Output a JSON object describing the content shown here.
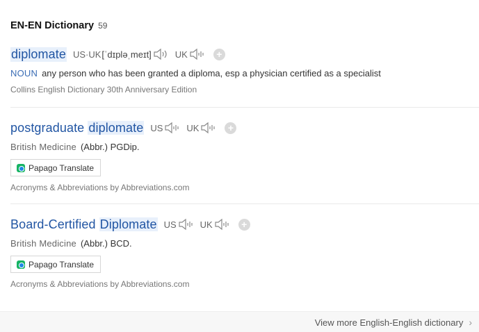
{
  "header": {
    "title": "EN-EN Dictionary",
    "count": "59"
  },
  "entries": [
    {
      "word": "diplomate",
      "us_uk_label": "US·UK",
      "phonetic": "[ˈdɪpləˌmeɪt]",
      "uk_label": "UK",
      "pos": "NOUN",
      "definition": "any person who has been granted a diploma, esp a physician certified as a specialist",
      "source": "Collins English Dictionary 30th Anniversary Edition"
    },
    {
      "word_prefix": "postgraduate ",
      "word_highlight": "diplomate",
      "us_label": "US",
      "uk_label": "UK",
      "pos": "British Medicine",
      "definition": "(Abbr.) PGDip.",
      "translate_label": "Papago Translate",
      "source": "Acronyms & Abbreviations by Abbreviations.com"
    },
    {
      "word_prefix": "Board-Certified ",
      "word_highlight": "Diplomate",
      "us_label": "US",
      "uk_label": "UK",
      "pos": "British Medicine",
      "definition": "(Abbr.) BCD.",
      "translate_label": "Papago Translate",
      "source": "Acronyms & Abbreviations by Abbreviations.com"
    }
  ],
  "footer": {
    "more_label": "View more English-English dictionary"
  },
  "icons": {
    "speaker": "speaker-icon",
    "add": "plus-icon",
    "translate": "papago-icon",
    "chevron": "chevron-right-icon"
  },
  "colors": {
    "link": "#2155a3",
    "highlight": "#e8f0fb",
    "pos": "#3b6db5"
  }
}
